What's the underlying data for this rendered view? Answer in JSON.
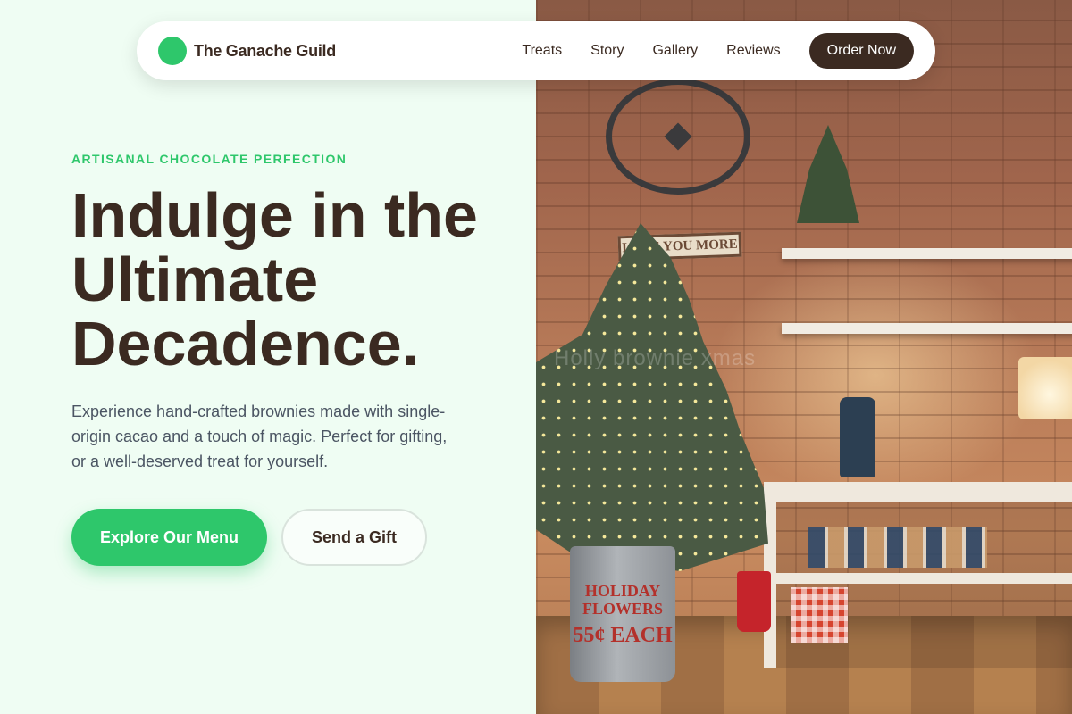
{
  "nav": {
    "brand": "The Ganache Guild",
    "links": [
      "Treats",
      "Story",
      "Gallery",
      "Reviews"
    ],
    "cta": "Order Now"
  },
  "hero": {
    "eyebrow": "ARTISANAL CHOCOLATE PERFECTION",
    "headline": "Indulge in the Ultimate Decadence.",
    "lede": "Experience hand-crafted brownies made with single-origin cacao and a touch of magic. Perfect for gifting, or a well-deserved treat for yourself.",
    "primary_cta": "Explore Our Menu",
    "secondary_cta": "Send a Gift"
  },
  "photo": {
    "sign_text": "LOVE YOU MORE",
    "pot_text_line1": "HOLIDAY",
    "pot_text_line2": "FLOWERS",
    "pot_price": "55¢ EACH",
    "watermark": "Holly brownie xmas"
  },
  "colors": {
    "accent": "#2ec76b",
    "brand_dark": "#3b2a21",
    "background": "#effdf3"
  }
}
